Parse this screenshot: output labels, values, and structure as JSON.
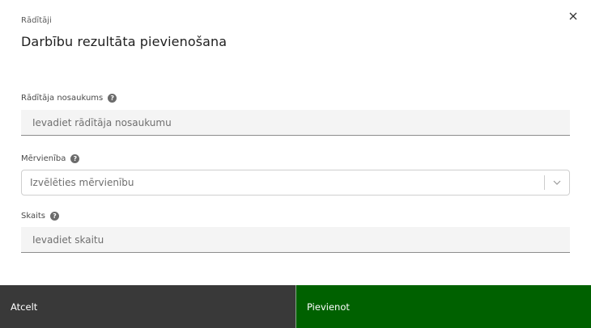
{
  "modal": {
    "eyebrow": "Rādītāji",
    "title": "Darbību rezultāta pievienošana",
    "close_icon": "close-icon"
  },
  "fields": {
    "name": {
      "label": "Rādītāja nosaukums",
      "help": "?",
      "placeholder": "Ievadiet rādītāja nosaukumu",
      "value": ""
    },
    "unit": {
      "label": "Mērvienība",
      "help": "?",
      "placeholder": "Izvēlēties mērvienību",
      "arrow_icon": "chevron-down-icon"
    },
    "count": {
      "label": "Skaits",
      "help": "?",
      "placeholder": "Ievadiet skaitu",
      "value": ""
    }
  },
  "footer": {
    "cancel_label": "Atcelt",
    "submit_label": "Pievienot"
  },
  "colors": {
    "cancel_bg": "#393939",
    "submit_bg": "#006100"
  }
}
